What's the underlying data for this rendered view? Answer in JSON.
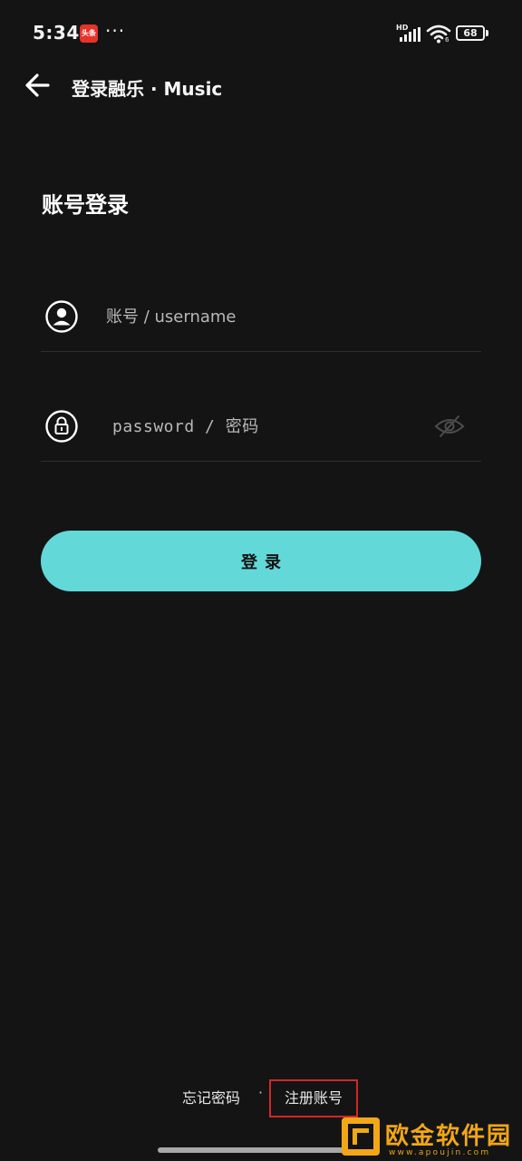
{
  "status_bar": {
    "time": "5:34",
    "app_notification": "头条",
    "more": "···",
    "network_badge": "HD",
    "wifi_badge": "6",
    "battery_level": "68"
  },
  "app_bar": {
    "title": "登录融乐 · Music"
  },
  "login": {
    "heading": "账号登录",
    "username_placeholder": "账号 / username",
    "password_placeholder": "password / 密码",
    "login_button": "登录"
  },
  "footer": {
    "forgot_password": "忘记密码",
    "separator": "·",
    "register": "注册账号"
  },
  "watermark": {
    "title": "欧金软件园",
    "url": "www.apoujin.com"
  },
  "colors": {
    "background": "#141414",
    "accent": "#63d8d8",
    "highlight_box": "#d3262a",
    "watermark": "#f2a716"
  }
}
